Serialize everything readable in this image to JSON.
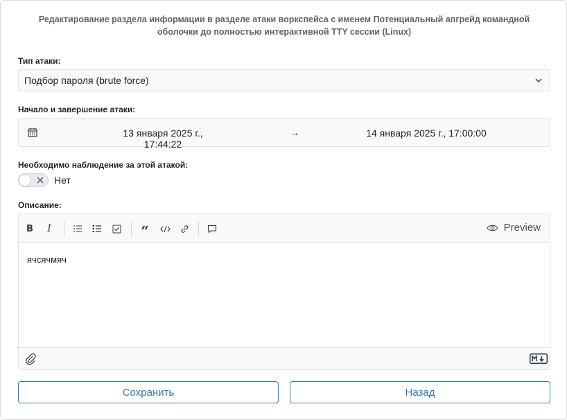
{
  "form": {
    "title": "Редактирование раздела информации в разделе атаки воркспейса с именем Потенциальный апгрейд командной оболочки до полностью интерактивной TTY сессии (Linux)",
    "attack_type": {
      "label": "Тип атаки:",
      "value": "Подбор пароля (brute force)"
    },
    "period": {
      "label": "Начало и завершение атаки:",
      "start": "13 января 2025 г., 17:44:22",
      "separator": "→",
      "end": "14 января 2025 г., 17:00:00"
    },
    "monitoring": {
      "label": "Необходимо наблюдение за этой атакой:",
      "enabled": false,
      "value_text": "Нет"
    },
    "description": {
      "label": "Описание:",
      "content": "ячсячмяч",
      "preview_label": "Preview",
      "toolbar": [
        "bold-icon",
        "italic-icon",
        "bulleted-list-icon",
        "numbered-list-icon",
        "checklist-icon",
        "quote-icon",
        "code-icon",
        "link-icon",
        "comment-icon"
      ]
    },
    "actions": {
      "save_label": "Сохранить",
      "back_label": "Назад"
    }
  },
  "colors": {
    "accent": "#2c7bbf",
    "field_bg": "#f8f9fa",
    "border": "#dee2e6"
  }
}
